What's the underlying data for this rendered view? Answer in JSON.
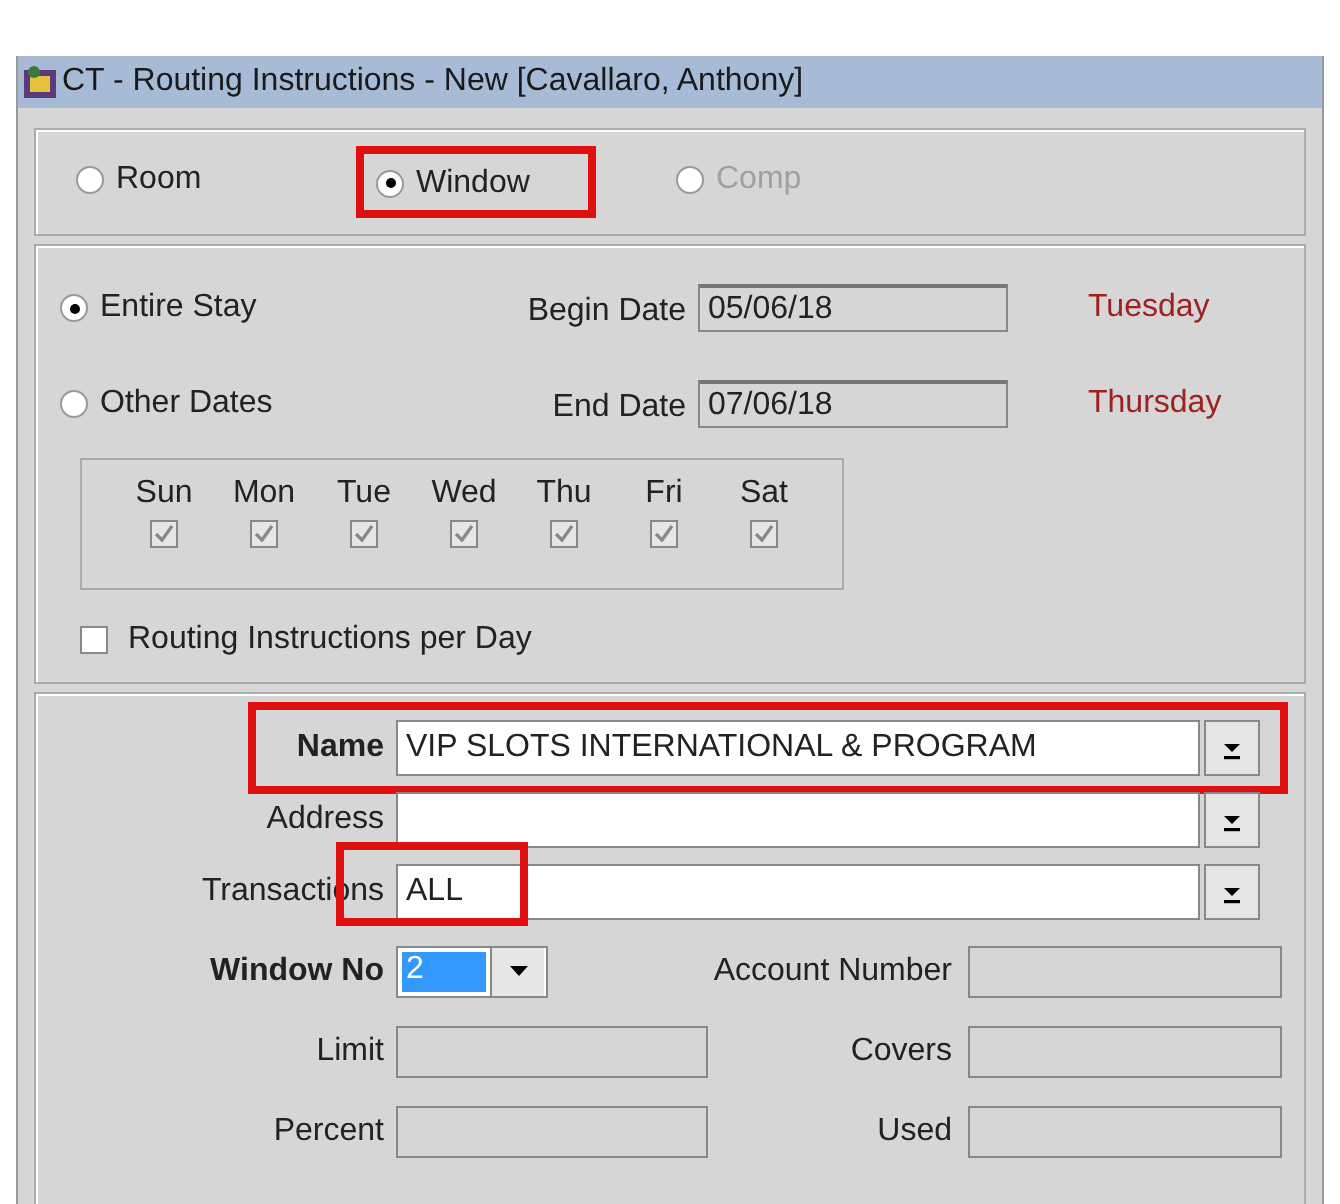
{
  "window": {
    "title": "CT - Routing Instructions - New [Cavallaro, Anthony]"
  },
  "route_types": [
    {
      "label": "Room",
      "selected": false,
      "disabled": false,
      "highlighted": false
    },
    {
      "label": "Window",
      "selected": true,
      "disabled": false,
      "highlighted": true
    },
    {
      "label": "Comp",
      "selected": false,
      "disabled": true,
      "highlighted": false
    }
  ],
  "date_modes": [
    {
      "label": "Entire Stay",
      "selected": true
    },
    {
      "label": "Other Dates",
      "selected": false
    }
  ],
  "dates": [
    {
      "label": "Begin Date",
      "value": "05/06/18",
      "weekday": "Tuesday"
    },
    {
      "label": "End Date",
      "value": "07/06/18",
      "weekday": "Thursday"
    }
  ],
  "days": [
    {
      "label": "Sun",
      "checked": true
    },
    {
      "label": "Mon",
      "checked": true
    },
    {
      "label": "Tue",
      "checked": true
    },
    {
      "label": "Wed",
      "checked": true
    },
    {
      "label": "Thu",
      "checked": true
    },
    {
      "label": "Fri",
      "checked": true
    },
    {
      "label": "Sat",
      "checked": true
    }
  ],
  "per_day": {
    "label": "Routing Instructions per Day",
    "checked": false
  },
  "lookups": [
    {
      "label": "Name",
      "value": "VIP SLOTS INTERNATIONAL & PROGRAM",
      "bold": true,
      "highlighted": true
    },
    {
      "label": "Address",
      "bold": false,
      "highlighted": false
    },
    {
      "label": "Transactions",
      "value": "ALL",
      "bold": false,
      "highlighted": true
    }
  ],
  "window_no": {
    "label": "Window No",
    "value": "2"
  },
  "account": {
    "label": "Account Number"
  },
  "totals": [
    {
      "label": "Limit"
    },
    {
      "label": "Covers"
    },
    {
      "label": "Percent"
    },
    {
      "label": "Used"
    }
  ]
}
